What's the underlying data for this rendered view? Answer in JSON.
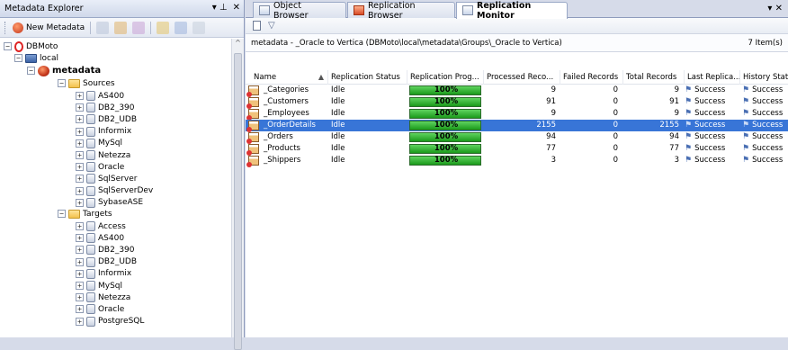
{
  "left_panel": {
    "title": "Metadata Explorer",
    "pin_glyph": "▾ ⊥",
    "close_glyph": "✕",
    "toolbar": {
      "new_metadata_label": "New Metadata"
    },
    "tree": {
      "root": "DBMoto",
      "server": "local",
      "metadata": "metadata",
      "sources_label": "Sources",
      "sources": [
        "AS400",
        "DB2_390",
        "DB2_UDB",
        "Informix",
        "MySql",
        "Netezza",
        "Oracle",
        "SqlServer",
        "SqlServerDev",
        "SybaseASE"
      ],
      "targets_label": "Targets",
      "targets": [
        "Access",
        "AS400",
        "DB2_390",
        "DB2_UDB",
        "Informix",
        "MySql",
        "Netezza",
        "Oracle",
        "PostgreSQL"
      ]
    }
  },
  "tabs": [
    {
      "label": "Object Browser",
      "icon": "object-browser-icon"
    },
    {
      "label": "Replication Browser",
      "icon": "replication-browser-icon"
    },
    {
      "label": "Replication Monitor",
      "icon": "replication-monitor-icon",
      "active": true
    }
  ],
  "tab_close_glyph": "▾ ✕",
  "path": {
    "text": "metadata - _Oracle to Vertica (DBMoto\\local\\metadata\\Groups\\_Oracle to Vertica)",
    "count": "7 Item(s)"
  },
  "grid": {
    "columns": [
      "Name",
      "Replication Status",
      "Replication Prog...",
      "Processed Reco...",
      "Failed Records",
      "Total Records",
      "Last Replica...",
      "History Stat"
    ],
    "rows": [
      {
        "name": "_Categories",
        "status": "Idle",
        "progress": 100,
        "progress_label": "100%",
        "processed": "9",
        "failed": "0",
        "total": "9",
        "last": "Success",
        "history": "Success"
      },
      {
        "name": "_Customers",
        "status": "Idle",
        "progress": 100,
        "progress_label": "100%",
        "processed": "91",
        "failed": "0",
        "total": "91",
        "last": "Success",
        "history": "Success"
      },
      {
        "name": "_Employees",
        "status": "Idle",
        "progress": 100,
        "progress_label": "100%",
        "processed": "9",
        "failed": "0",
        "total": "9",
        "last": "Success",
        "history": "Success"
      },
      {
        "name": "_OrderDetails",
        "status": "Idle",
        "progress": 100,
        "progress_label": "100%",
        "processed": "2155",
        "failed": "0",
        "total": "2155",
        "last": "Success",
        "history": "Success",
        "selected": true
      },
      {
        "name": "_Orders",
        "status": "Idle",
        "progress": 100,
        "progress_label": "100%",
        "processed": "94",
        "failed": "0",
        "total": "94",
        "last": "Success",
        "history": "Success"
      },
      {
        "name": "_Products",
        "status": "Idle",
        "progress": 100,
        "progress_label": "100%",
        "processed": "77",
        "failed": "0",
        "total": "77",
        "last": "Success",
        "history": "Success"
      },
      {
        "name": "_Shippers",
        "status": "Idle",
        "progress": 100,
        "progress_label": "100%",
        "processed": "3",
        "failed": "0",
        "total": "3",
        "last": "Success",
        "history": "Success"
      }
    ]
  },
  "colors": {
    "selection": "#3875d7",
    "progress": "#1b9a1b",
    "header_bg": "#d6dbe9"
  }
}
